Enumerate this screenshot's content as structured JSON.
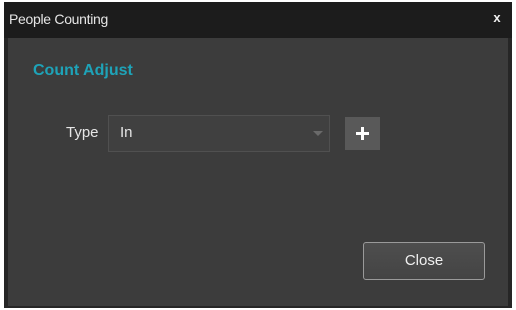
{
  "window": {
    "title": "People Counting",
    "close_glyph": "x"
  },
  "panel": {
    "heading": "Count Adjust",
    "type_label": "Type",
    "type_select": {
      "value": "In",
      "options": [
        "In"
      ]
    },
    "add_icon": "plus-icon"
  },
  "footer": {
    "close_label": "Close"
  },
  "colors": {
    "heading_accent": "#1ea3b8",
    "panel_bg": "#3c3c3c",
    "frame_bg": "#262626"
  }
}
